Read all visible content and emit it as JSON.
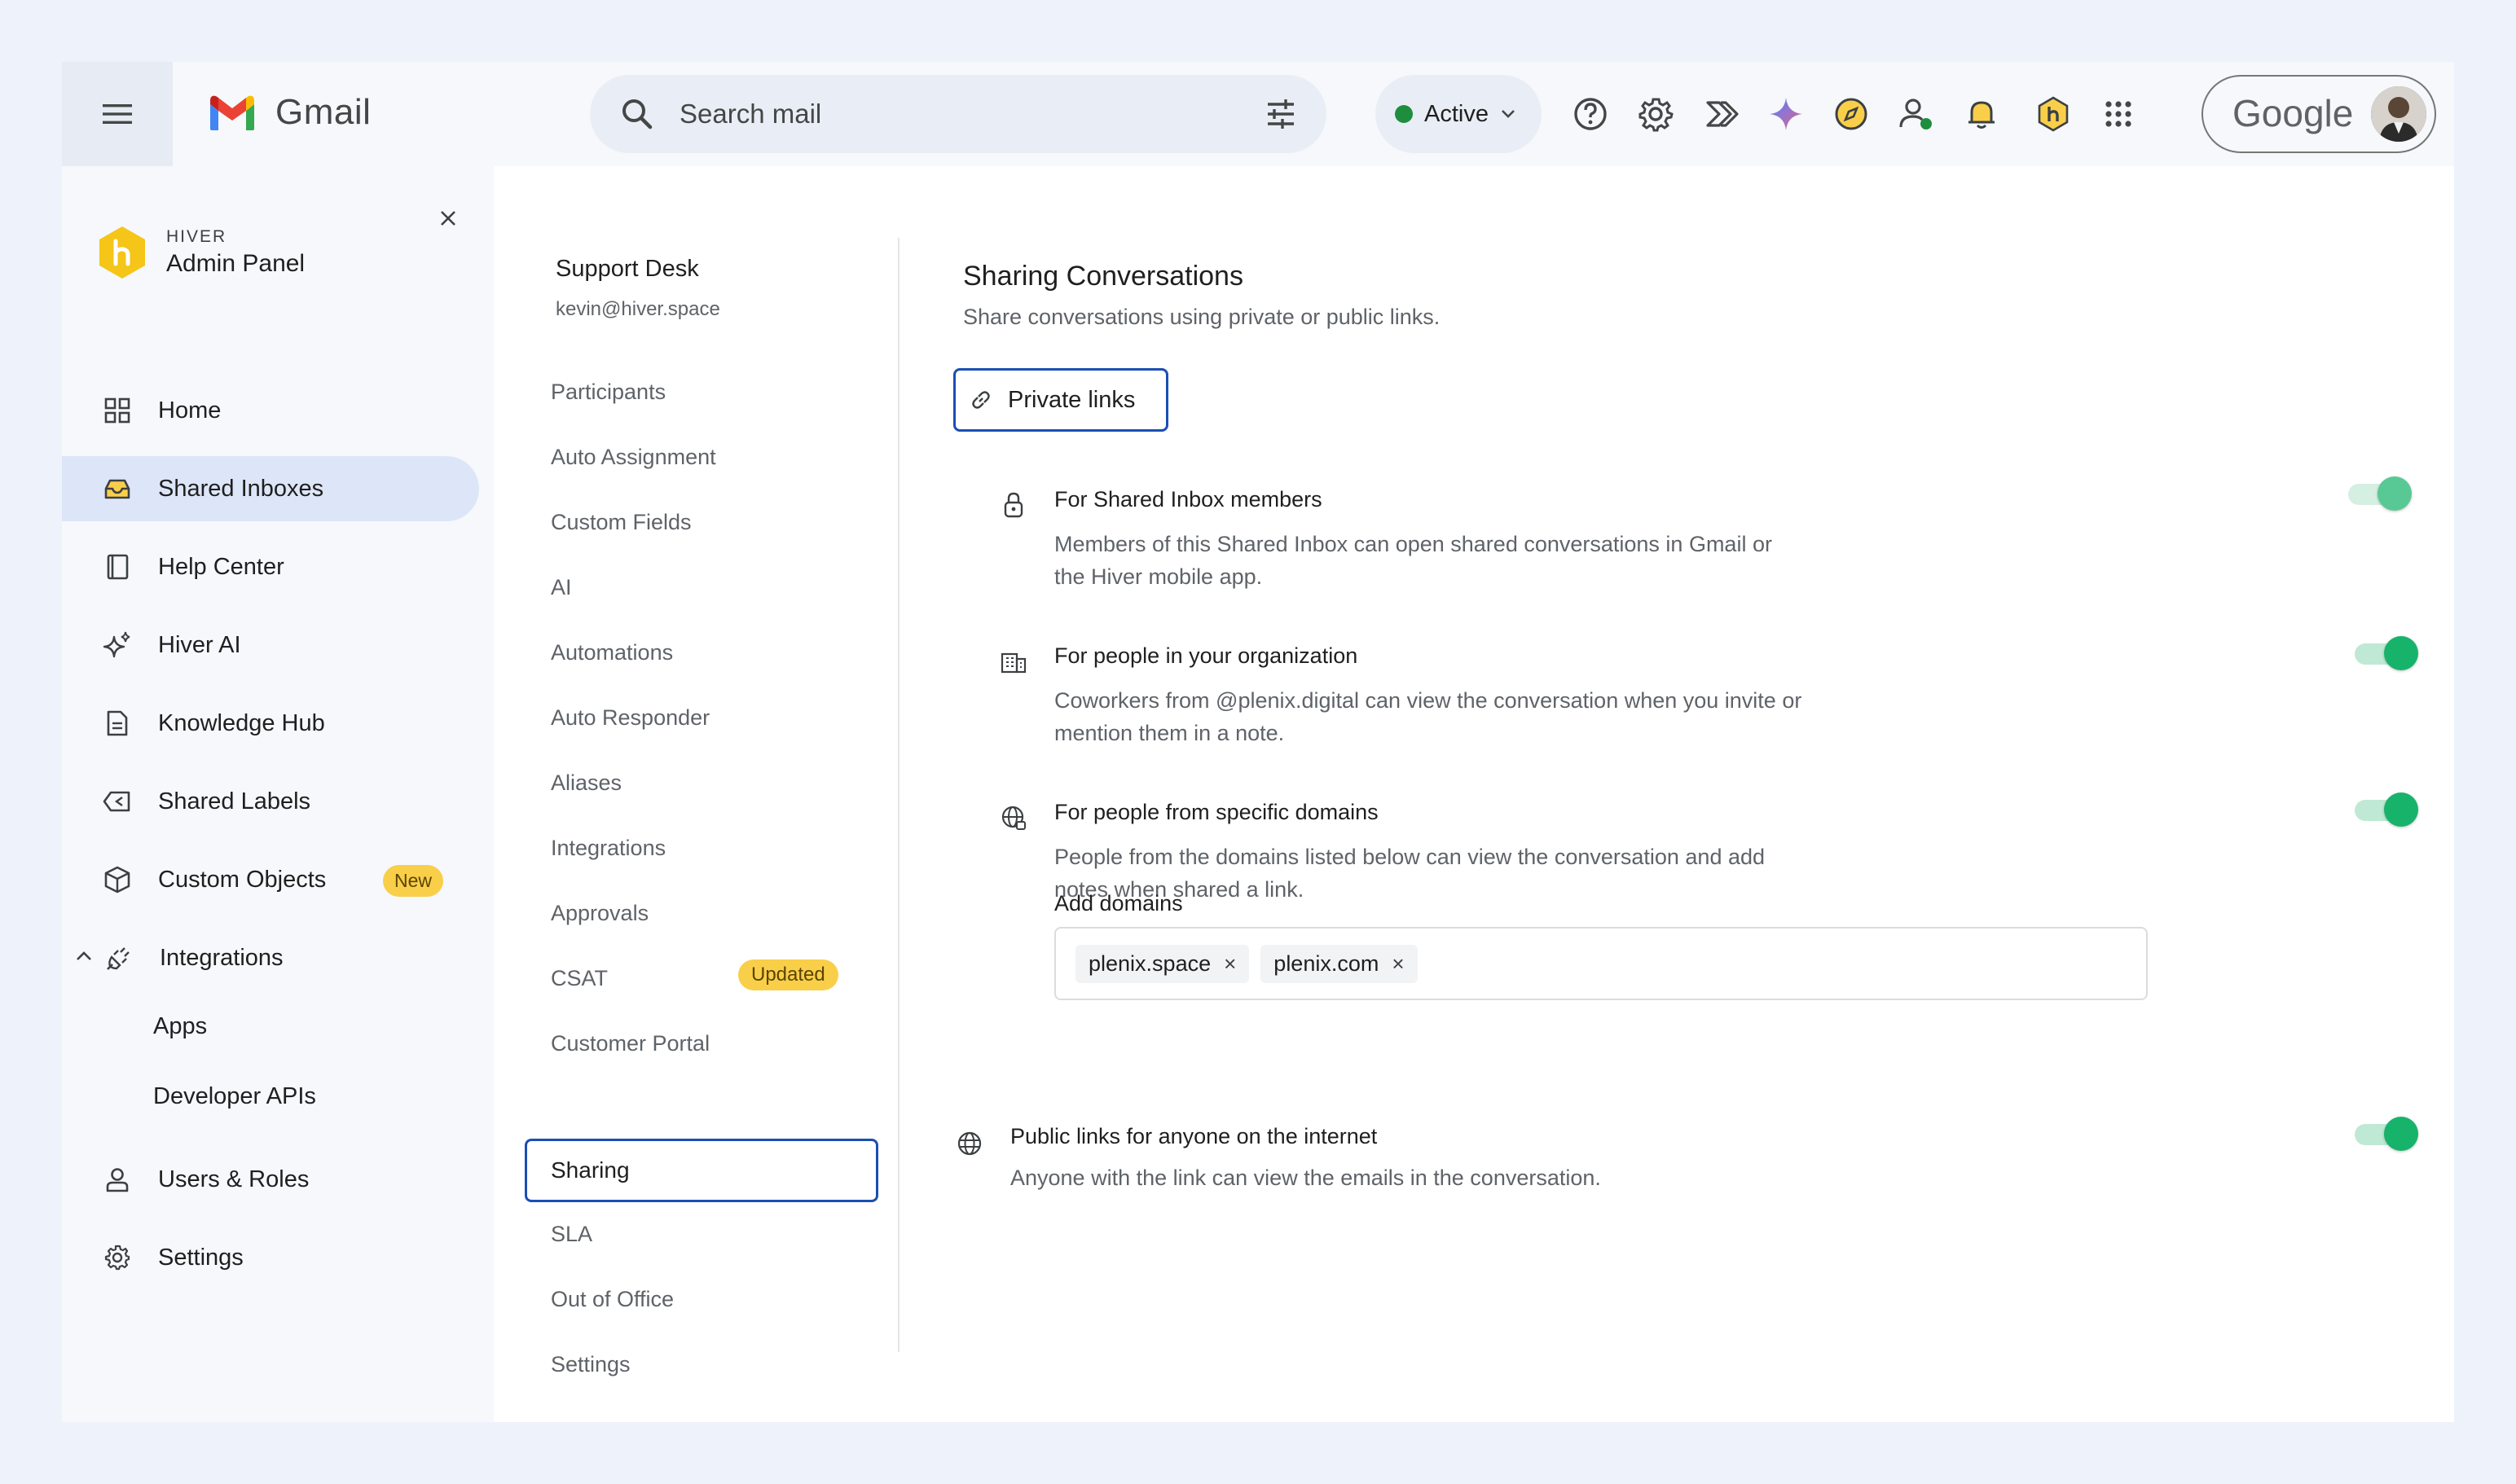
{
  "app": {
    "name": "Gmail",
    "search_placeholder": "Search mail",
    "status": "Active",
    "account_brand": "Google",
    "brand_colors": {
      "accent": "#1a4fb4",
      "toggle_on": "#17b36b",
      "badge": "#f9cf4a",
      "status_green": "#1e8e3e"
    }
  },
  "top_icons": [
    "help-icon",
    "settings-gear-icon",
    "hiver-flow-icon",
    "gemini-sparkle-icon",
    "compass-icon",
    "contact-status-icon",
    "bell-icon",
    "hiver-hex-icon",
    "apps-grid-icon"
  ],
  "sidenav": {
    "brand_small": "HIVER",
    "brand_big": "Admin Panel",
    "items": [
      {
        "label": "Home",
        "icon": "grid-icon"
      },
      {
        "label": "Shared Inboxes",
        "icon": "inbox-icon",
        "active": true
      },
      {
        "label": "Help Center",
        "icon": "book-icon"
      },
      {
        "label": "Hiver AI",
        "icon": "sparkle-icon"
      },
      {
        "label": "Knowledge Hub",
        "icon": "document-icon"
      },
      {
        "label": "Shared Labels",
        "icon": "label-share-icon"
      },
      {
        "label": "Custom Objects",
        "icon": "cube-icon",
        "badge": "New"
      },
      {
        "label": "Integrations",
        "icon": "plug-icon",
        "expanded": true
      }
    ],
    "sub_items": [
      "Apps",
      "Developer APIs"
    ],
    "bottom_items": [
      {
        "label": "Users & Roles",
        "icon": "user-icon"
      },
      {
        "label": "Settings",
        "icon": "gear-icon"
      }
    ]
  },
  "inbox": {
    "name": "Support Desk",
    "email": "kevin@hiver.space",
    "settings_menu": [
      "Participants",
      "Auto Assignment",
      "Custom Fields",
      "AI",
      "Automations",
      "Auto Responder",
      "Aliases",
      "Integrations",
      "Approvals",
      "CSAT",
      "Customer Portal",
      "Sharing",
      "SLA",
      "Out of Office",
      "Settings"
    ],
    "csat_badge": "Updated",
    "active_item": "Sharing"
  },
  "sharing": {
    "title": "Sharing Conversations",
    "subtitle": "Share conversations using private or public links.",
    "private_tab": "Private links",
    "options": [
      {
        "title": "For Shared Inbox members",
        "desc": "Members of this Shared Inbox can open shared conversations in Gmail or the Hiver mobile app.",
        "enabled": true
      },
      {
        "title": "For people in your organization",
        "desc": "Coworkers from @plenix.digital can view the conversation when you invite or mention them in a note.",
        "enabled": true
      },
      {
        "title": "For people from specific domains",
        "desc": "People from the domains listed below can view the conversation and add notes when shared a link.",
        "enabled": true
      }
    ],
    "domains_label": "Add domains",
    "domains": [
      "plenix.space",
      "plenix.com"
    ],
    "public": {
      "title": "Public links for anyone on the internet",
      "desc": "Anyone with the link can view the emails in the conversation.",
      "enabled": true
    }
  }
}
